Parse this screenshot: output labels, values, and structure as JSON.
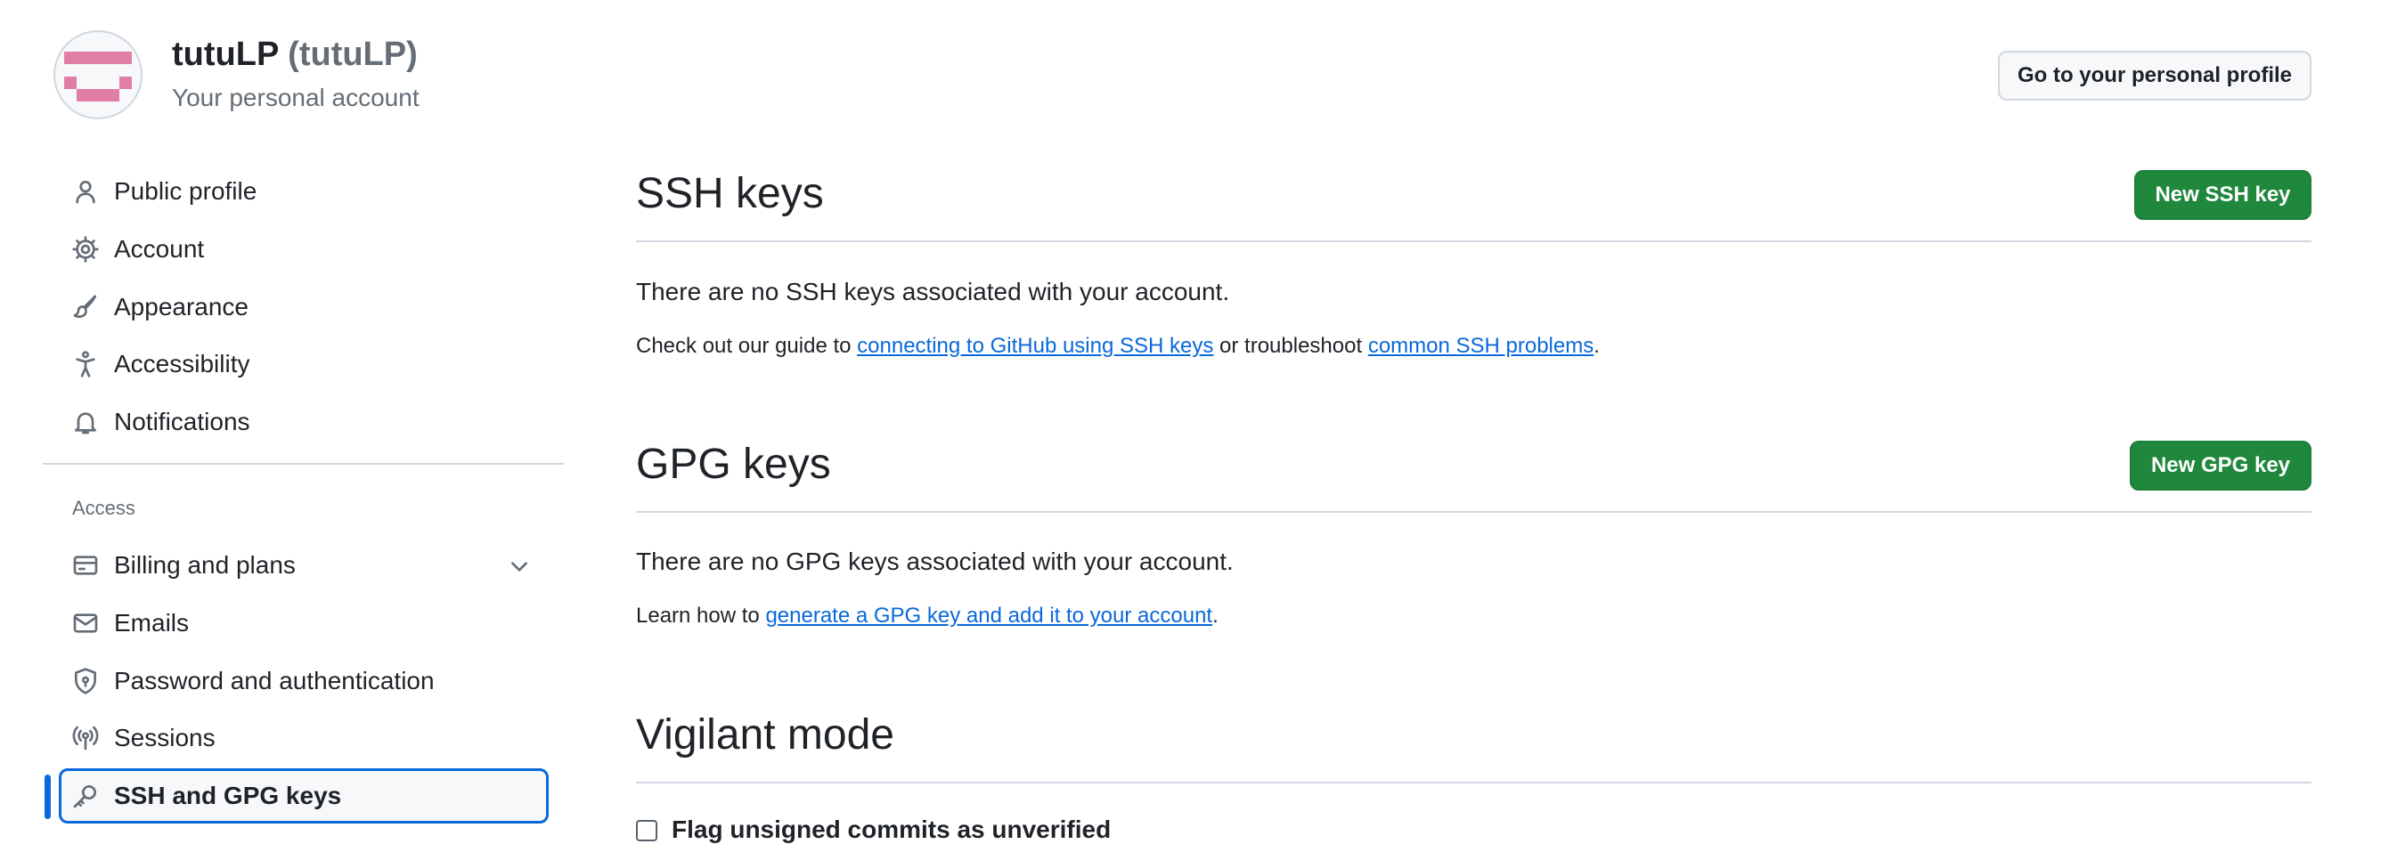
{
  "colors": {
    "accent": "#0969da",
    "primary_button": "#1f883d",
    "muted_text": "#656d76",
    "avatar": "#e07fa3"
  },
  "header": {
    "display_name": "tutuLP",
    "login": "(tutuLP)",
    "subtitle": "Your personal account",
    "profile_button": "Go to your personal profile"
  },
  "sidebar": {
    "items": [
      {
        "label": "Public profile",
        "icon": "person-icon"
      },
      {
        "label": "Account",
        "icon": "gear-icon"
      },
      {
        "label": "Appearance",
        "icon": "paintbrush-icon"
      },
      {
        "label": "Accessibility",
        "icon": "accessibility-icon"
      },
      {
        "label": "Notifications",
        "icon": "bell-icon"
      }
    ],
    "access_heading": "Access",
    "access_items": [
      {
        "label": "Billing and plans",
        "icon": "credit-card-icon",
        "expandable": true
      },
      {
        "label": "Emails",
        "icon": "mail-icon"
      },
      {
        "label": "Password and authentication",
        "icon": "shield-lock-icon"
      },
      {
        "label": "Sessions",
        "icon": "broadcast-icon"
      },
      {
        "label": "SSH and GPG keys",
        "icon": "key-icon",
        "active": true
      }
    ]
  },
  "ssh": {
    "title": "SSH keys",
    "new_button": "New SSH key",
    "empty_text": "There are no SSH keys associated with your account.",
    "guide_prefix": "Check out our guide to ",
    "guide_link": "connecting to GitHub using SSH keys",
    "guide_middle": " or troubleshoot ",
    "problems_link": "common SSH problems",
    "guide_suffix": "."
  },
  "gpg": {
    "title": "GPG keys",
    "new_button": "New GPG key",
    "empty_text": "There are no GPG keys associated with your account.",
    "learn_prefix": "Learn how to ",
    "learn_link": "generate a GPG key and add it to your account",
    "learn_suffix": "."
  },
  "vigilant": {
    "title": "Vigilant mode",
    "checkbox_label": "Flag unsigned commits as unverified",
    "checked": false
  }
}
